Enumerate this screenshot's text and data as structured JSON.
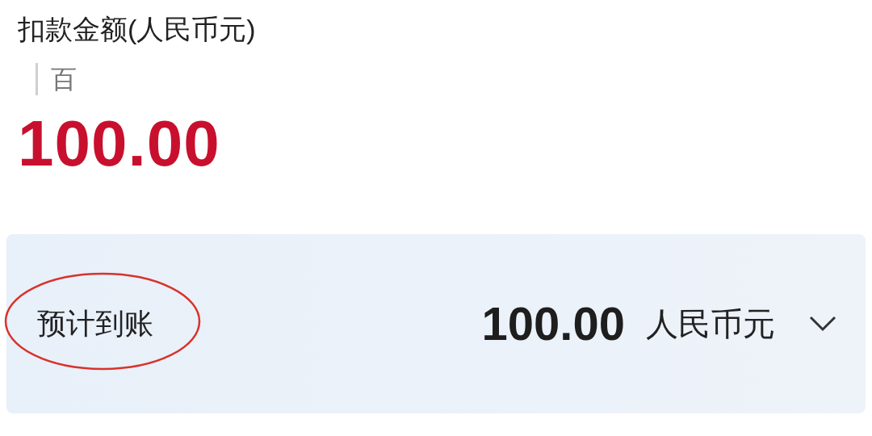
{
  "amount_label": "扣款金额(人民币元)",
  "unit_hint": "百",
  "amount": "100.00",
  "arrival": {
    "label": "预计到账",
    "amount": "100.00",
    "currency": "人民币元"
  }
}
